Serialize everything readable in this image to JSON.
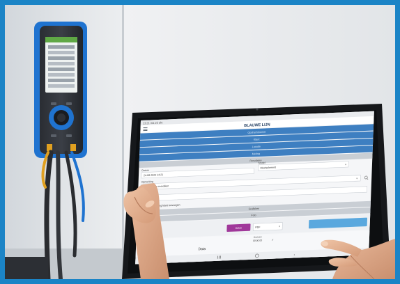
{
  "tablet": {
    "status_time": "13:21 ma 23 okt",
    "title": "BLAUWE LIJN",
    "blue_sections": [
      "Opdrachtnemer",
      "Klant",
      "Locatie",
      "Meting"
    ],
    "results_header": "Resultaten",
    "datum_label": "Datum",
    "datum_value": "24-08-2023 14:21",
    "model_label": "Model",
    "model_value": "Meetselement",
    "opmerking_label": "Opmerking",
    "opmerking_value": "Cv-installatie-vervolken",
    "testresultaat_label": "Testresultaat",
    "testresultaat_value": "geslaagd",
    "checkbox_label": "Handtekening klant toevoegen",
    "grafieken_label": "Grafieken",
    "foto_label": "Foto",
    "pink_button": "Delen",
    "format_select": "PDF",
    "status_label": "Gesloten",
    "timestamp": "00:00:00",
    "data_label": "Data"
  },
  "colors": {
    "frame": "#1b84c6",
    "section_blue": "#3e7fc1",
    "pink_button": "#a0389a",
    "device_blue": "#1f73d0"
  }
}
